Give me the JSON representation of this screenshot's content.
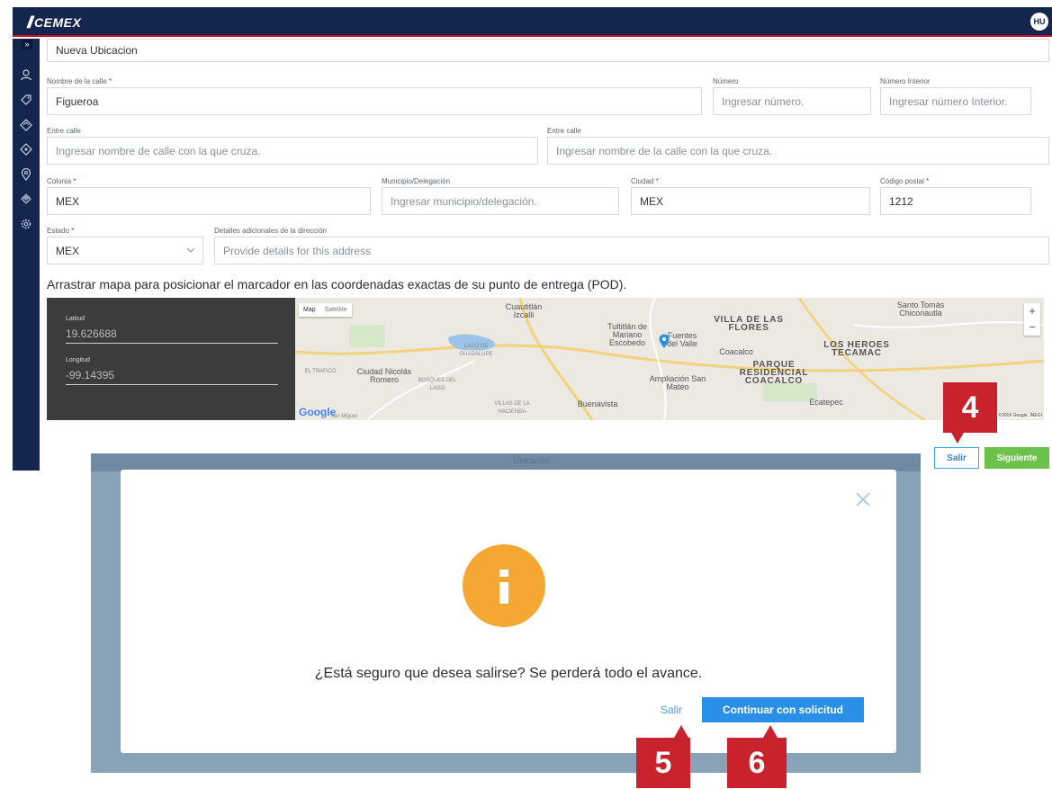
{
  "app": {
    "brand": "CEMEX",
    "avatar_initials": "HU"
  },
  "form": {
    "location_name": "Nueva Ubicacion",
    "street": {
      "label": "Nombre de la calle",
      "value": "Figueroa"
    },
    "number": {
      "label": "Número",
      "placeholder": "Ingresar número."
    },
    "interior": {
      "label": "Número Interior",
      "placeholder": "Ingresar número Interior."
    },
    "cross1": {
      "label": "Entre calle",
      "placeholder": "Ingresar nombre de calle con la que cruza."
    },
    "cross2": {
      "label": "Entre calle",
      "placeholder": "Ingresar nombre de la calle con la que cruza."
    },
    "colonia": {
      "label": "Colonia",
      "value": "MEX"
    },
    "municipio": {
      "label": "Municipio/Delegación",
      "placeholder": "Ingresar municipio/delegación."
    },
    "ciudad": {
      "label": "Ciudad",
      "value": "MEX"
    },
    "cp": {
      "label": "Código postal",
      "value": "1212"
    },
    "estado": {
      "label": "Estado",
      "value": "MEX"
    },
    "details": {
      "label": "Detalles adicionales de la dirección",
      "placeholder": "Provide details for this address"
    },
    "required_mark": "*"
  },
  "map": {
    "instruction": "Arrastrar mapa para posicionar el marcador en las coordenadas exactas de su punto de entrega (POD).",
    "lat_label": "Latitud",
    "lat_value": "19.626688",
    "lng_label": "Longitud",
    "lng_value": "-99.14395",
    "type_map": "Map",
    "type_satellite": "Satellite",
    "zoom_in": "+",
    "zoom_out": "−",
    "google": "Google",
    "attribution": "Map data ©2019 Google, INEGI",
    "labels": {
      "cuautitlan": "Cuautitlán Izcalli",
      "tultitlan": "Tultitlán de Mariano Escobedo",
      "fuentes": "Fuentes del Valle",
      "villa": "VILLA DE LAS FLORES",
      "santo_tomas": "Santo Tomás Chiconautla",
      "coacalco": "Coacalco",
      "heroes": "LOS HEROES TECAMAC",
      "parque": "PARQUE RESIDENCIAL COACALCO",
      "nicolas": "Ciudad Nicolás Romero",
      "ampliacion": "Ampliación San Mateo",
      "buenavista": "Buenavista",
      "ecatepec": "Ecatepec",
      "lago": "LAGO DE GUADALUPE",
      "trafico": "EL TRAFICO",
      "bosques": "BOSQUES DEL LAGO",
      "villas_hacienda": "VILLAS DE LA HACIENDA",
      "san_miguel": "San Miguel"
    }
  },
  "actions": {
    "salir": "Salir",
    "siguiente": "Siguiente"
  },
  "callouts": {
    "c4": "4",
    "c5": "5",
    "c6": "6"
  },
  "modal": {
    "bg_text": "Ubicación",
    "message": "¿Está seguro que desea salirse? Se perderá todo el avance.",
    "salir": "Salir",
    "continuar": "Continuar con solicitud",
    "info_glyph": "i"
  },
  "colors": {
    "navy": "#14264e",
    "accent_red": "#c8232c",
    "primary_blue": "#2a8fe6",
    "green": "#6cc24a",
    "warning_orange": "#f5a734"
  }
}
